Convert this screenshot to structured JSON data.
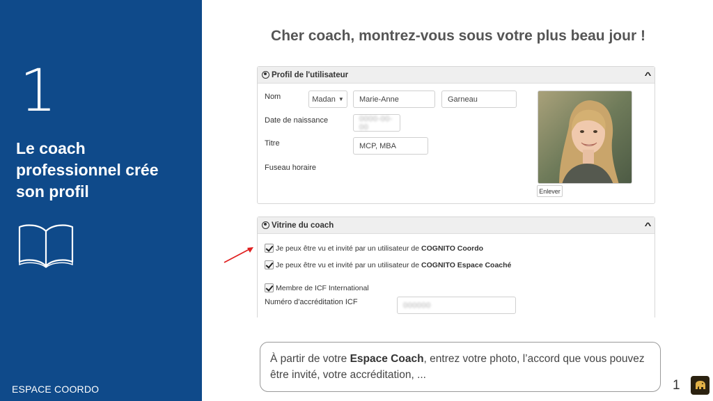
{
  "sidebar": {
    "step_number": "1",
    "title": "Le coach professionnel crée son profil",
    "footer": "ESPACE COORDO"
  },
  "main": {
    "title": "Cher coach, montrez-vous sous votre plus beau jour !"
  },
  "profile_panel": {
    "header": "Profil de l'utilisateur",
    "labels": {
      "name": "Nom",
      "birthdate": "Date de naissance",
      "title": "Titre",
      "timezone": "Fuseau horaire"
    },
    "salutation": "Madan",
    "first_name": "Marie-Anne",
    "last_name": "Garneau",
    "birthdate_value": "0000-00-00",
    "title_value": "MCP, MBA",
    "remove_button": "Enlever"
  },
  "showcase_panel": {
    "header": "Vitrine du coach",
    "check1_text": "Je peux être vu et invité par un utilisateur de",
    "check1_bold": "COGNITO Coordo",
    "check2_text": "Je peux être vu et invité par un utilisateur de",
    "check2_bold": "COGNITO Espace Coaché",
    "check3_text": "Membre de ICF International",
    "accreditation_label": "Numéro d'accréditation ICF",
    "accreditation_value": "000000"
  },
  "callout": {
    "part1": "À partir de votre ",
    "bold": "Espace Coach",
    "part2": ", entrez votre photo, l’accord que vous pouvez être invité, votre accréditation, ..."
  },
  "page_number": "1",
  "colors": {
    "sidebar_bg": "#0f4a8a",
    "arrow": "#e02020"
  }
}
